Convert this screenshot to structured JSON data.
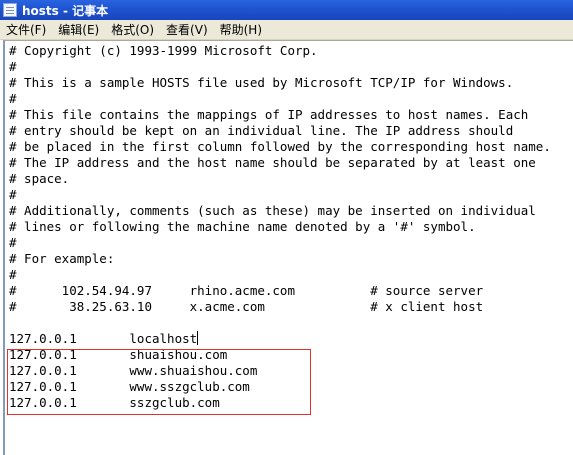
{
  "window": {
    "title": "hosts - 记事本",
    "icon": "notepad-icon"
  },
  "menu": [
    "文件(F)",
    "编辑(E)",
    "格式(O)",
    "查看(V)",
    "帮助(H)"
  ],
  "editor": {
    "lines": [
      "# Copyright (c) 1993-1999 Microsoft Corp.",
      "#",
      "# This is a sample HOSTS file used by Microsoft TCP/IP for Windows.",
      "#",
      "# This file contains the mappings of IP addresses to host names. Each",
      "# entry should be kept on an individual line. The IP address should",
      "# be placed in the first column followed by the corresponding host name.",
      "# The IP address and the host name should be separated by at least one",
      "# space.",
      "#",
      "# Additionally, comments (such as these) may be inserted on individual",
      "# lines or following the machine name denoted by a '#' symbol.",
      "#",
      "# For example:",
      "#",
      "#      102.54.94.97     rhino.acme.com          # source server",
      "#       38.25.63.10     x.acme.com              # x client host",
      "",
      "127.0.0.1       localhost",
      "127.0.0.1       shuaishou.com",
      "127.0.0.1       www.shuaishou.com",
      "127.0.0.1       www.sszgclub.com",
      "127.0.0.1       sszgclub.com"
    ],
    "caret_line": 18,
    "highlight_color": "#e03030"
  }
}
